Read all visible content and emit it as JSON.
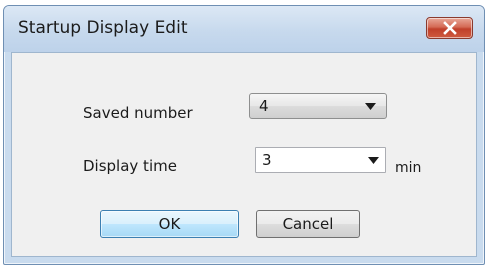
{
  "window": {
    "title": "Startup Display Edit"
  },
  "icons": {
    "close": "close-icon",
    "dropdown": "chevron-down-icon"
  },
  "form": {
    "saved_number": {
      "label": "Saved number",
      "value": "4"
    },
    "display_time": {
      "label": "Display time",
      "value": "3",
      "unit": "min"
    }
  },
  "buttons": {
    "ok_label": "OK",
    "cancel_label": "Cancel"
  },
  "colors": {
    "titlebar": "#c7d9ed",
    "close_button": "#c7503a",
    "client_background": "#f0f0f0",
    "default_button": "#bee6fd"
  }
}
